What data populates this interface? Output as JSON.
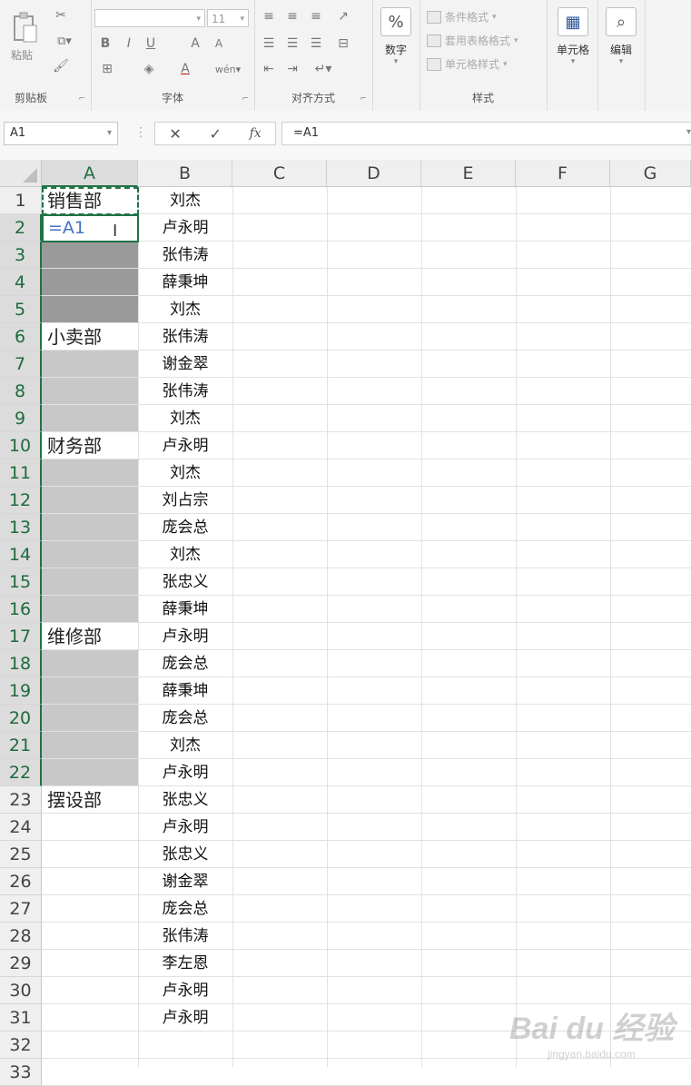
{
  "ribbon": {
    "clipboard": {
      "paste_label": "粘贴",
      "group_label": "剪贴板"
    },
    "font": {
      "font_name_value": "",
      "font_size_value": "11",
      "bold": "B",
      "italic": "I",
      "underline": "U",
      "grow": "A",
      "shrink": "A",
      "group_label": "字体"
    },
    "alignment": {
      "group_label": "对齐方式"
    },
    "number": {
      "percent_symbol": "%",
      "label": "数字"
    },
    "styles": {
      "conditional_format": "条件格式",
      "table_format": "套用表格格式",
      "cell_styles": "单元格样式",
      "group_label": "样式"
    },
    "cells": {
      "label": "单元格"
    },
    "editing": {
      "label": "编辑"
    }
  },
  "formula_bar": {
    "name_box": "A1",
    "formula": "=A1",
    "fx": "fx"
  },
  "columns": [
    "A",
    "B",
    "C",
    "D",
    "E",
    "F",
    "G"
  ],
  "rows": [
    "1",
    "2",
    "3",
    "4",
    "5",
    "6",
    "7",
    "8",
    "9",
    "10",
    "11",
    "12",
    "13",
    "14",
    "15",
    "16",
    "17",
    "18",
    "19",
    "20",
    "21",
    "22",
    "23",
    "24",
    "25",
    "26",
    "27",
    "28",
    "29",
    "30",
    "31",
    "32",
    "33"
  ],
  "column_a": {
    "r1": "销售部",
    "r2_edit": "=A1",
    "r6": "小卖部",
    "r10": "财务部",
    "r17": "维修部",
    "r23": "摆设部"
  },
  "column_b": [
    "刘杰",
    "卢永明",
    "张伟涛",
    "薛秉坤",
    "刘杰",
    "张伟涛",
    "谢金翠",
    "张伟涛",
    "刘杰",
    "卢永明",
    "刘杰",
    "刘占宗",
    "庞会总",
    "刘杰",
    "张忠义",
    "薛秉坤",
    "卢永明",
    "庞会总",
    "薛秉坤",
    "庞会总",
    "刘杰",
    "卢永明",
    "张忠义",
    "卢永明",
    "张忠义",
    "谢金翠",
    "庞会总",
    "张伟涛",
    "李左恩",
    "卢永明",
    "卢永明"
  ],
  "watermark": {
    "brand": "Bai du 经验",
    "url": "jingyan.baidu.com"
  }
}
